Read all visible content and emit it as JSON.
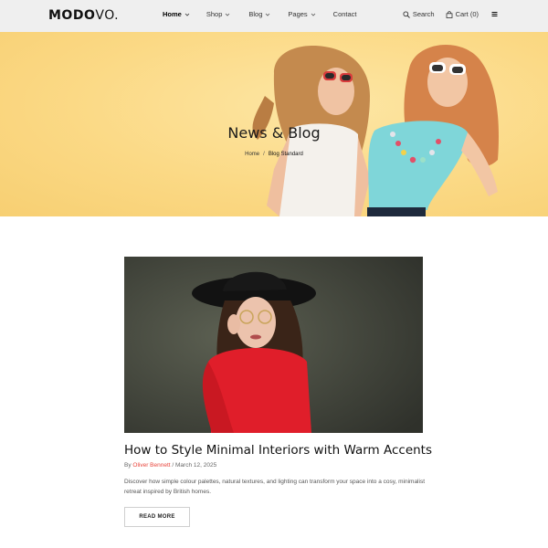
{
  "header": {
    "logo_bold": "MODO",
    "logo_light": "VO.",
    "nav": [
      {
        "label": "Home",
        "active": true
      },
      {
        "label": "Shop"
      },
      {
        "label": "Blog"
      },
      {
        "label": "Pages"
      },
      {
        "label": "Contact"
      }
    ],
    "search_label": "Search",
    "cart_label": "Cart (0)"
  },
  "hero": {
    "title": "News & Blog",
    "breadcrumb": {
      "home": "Home",
      "current": "Blog Standard"
    },
    "bg_color": "#fbd985"
  },
  "post": {
    "title": "How to Style Minimal Interiors with Warm Accents",
    "by": "By",
    "author": "Oliver Bennett",
    "date": "/ March 12, 2025",
    "excerpt": "Discover how simple colour palettes, natural textures, and lighting can transform your space into a cosy, minimalist retreat inspired by British homes.",
    "read_more": "READ MORE"
  },
  "colors": {
    "accent": "#e8453c",
    "header_bg": "#efefef"
  }
}
